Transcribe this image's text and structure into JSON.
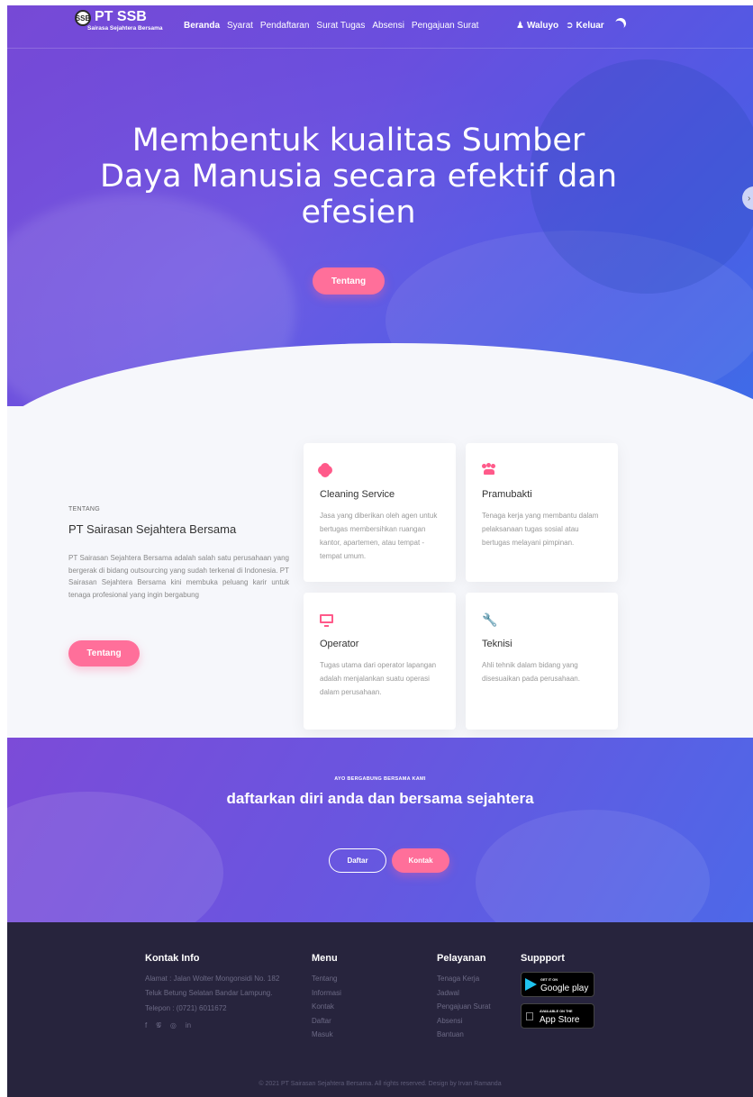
{
  "nav": {
    "logo_badge": "SSB",
    "logo_title": "PT SSB",
    "logo_subtitle": "Sairasa Sejahtera Bersama",
    "items": [
      {
        "label": "Beranda"
      },
      {
        "label": "Syarat"
      },
      {
        "label": "Pendaftaran"
      },
      {
        "label": "Surat Tugas"
      },
      {
        "label": "Absensi"
      },
      {
        "label": "Pengajuan Surat"
      }
    ],
    "user_name": "Waluyo",
    "logout_label": "Keluar"
  },
  "hero": {
    "headline": "Membentuk kualitas Sumber Daya Manusia secara efektif dan efesien",
    "button_label": "Tentang",
    "next_arrow": "›"
  },
  "about": {
    "label": "TENTANG",
    "title": "PT Sairasan Sejahtera Bersama",
    "text": "PT Sairasan Sejahtera Bersama adalah salah satu perusahaan yang bergerak di bidang outsourcing yang sudah terkenal di Indonesia. PT Sairasan Sejahtera Bersama kini membuka peluang karir untuk tenaga profesional yang ingin bergabung",
    "button_label": "Tentang"
  },
  "services": [
    {
      "icon": "gear-icon",
      "title": "Cleaning Service",
      "text": "Jasa yang diberikan oleh agen untuk bertugas membersihkan ruangan kantor, apartemen, atau tempat - tempat umum."
    },
    {
      "icon": "users-icon",
      "title": "Pramubakti",
      "text": "Tenaga kerja yang membantu dalam pelaksanaan tugas sosial atau bertugas melayani pimpinan."
    },
    {
      "icon": "monitor-icon",
      "title": "Operator",
      "text": "Tugas utama dari operator lapangan adalah menjalankan suatu operasi dalam perusahaan."
    },
    {
      "icon": "wrench-icon",
      "title": "Teknisi",
      "text": "Ahli tehnik dalam bidang yang disesuaikan pada perusahaan."
    }
  ],
  "cta": {
    "subtitle": "AYO BERGABUNG BERSAMA KAMI",
    "title": "daftarkan diri anda dan bersama sejahtera",
    "register_label": "Daftar",
    "contact_label": "Kontak"
  },
  "footer": {
    "contact_title": "Kontak Info",
    "address": "Alamat : Jalan Wolter Mongonsidi No. 182 Teluk Betung Selatan Bandar Lampung.",
    "phone": "Telepon : (0721) 6011672",
    "menu_title": "Menu",
    "menu_items": [
      "Tentang",
      "Informasi",
      "Kontak",
      "Daftar",
      "Masuk"
    ],
    "services_title": "Pelayanan",
    "services_items": [
      "Tenaga Kerja",
      "Jadwal",
      "Pengajuan Surat",
      "Absensi",
      "Bantuan"
    ],
    "support_title": "Suppport",
    "google_small": "GET IT ON",
    "google_big": "Google play",
    "apple_small": "AVAILABLE ON THE",
    "apple_big": "App Store",
    "copyright": "© 2021 PT Sairasan Sejahtera Bersama. All rights reserved. Design by Irvan Ramanda"
  },
  "colors": {
    "accent_pink": "#ff6f9a",
    "footer_bg": "#27243d",
    "hero_purple": "#7848d7",
    "hero_blue": "#3a6eeb"
  }
}
